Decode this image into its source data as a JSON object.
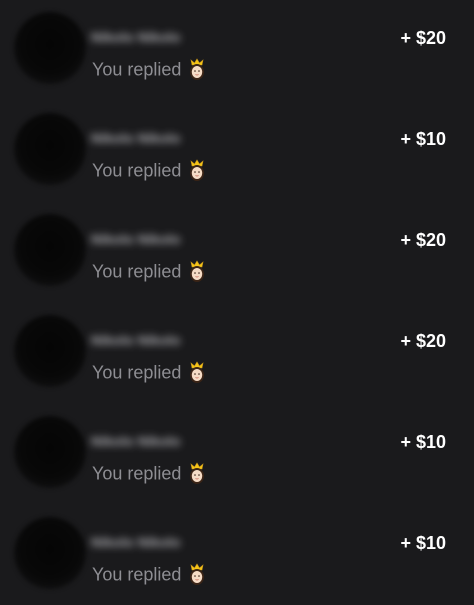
{
  "messages": [
    {
      "name": "Nikolo Nikolo",
      "subtitle": "You replied",
      "icon": "queen-emoji-icon",
      "amount": "+ $20"
    },
    {
      "name": "Nikolo Nikolo",
      "subtitle": "You replied",
      "icon": "queen-emoji-icon",
      "amount": "+ $10"
    },
    {
      "name": "Nikolo Nikolo",
      "subtitle": "You replied",
      "icon": "queen-emoji-icon",
      "amount": "+ $20"
    },
    {
      "name": "Nikolo Nikolo",
      "subtitle": "You replied",
      "icon": "queen-emoji-icon",
      "amount": "+ $20"
    },
    {
      "name": "Nikolo Nikolo",
      "subtitle": "You replied",
      "icon": "queen-emoji-icon",
      "amount": "+ $10"
    },
    {
      "name": "Nikolo Nikolo",
      "subtitle": "You replied",
      "icon": "queen-emoji-icon",
      "amount": "+ $10"
    }
  ],
  "colors": {
    "background": "#1a1a1c",
    "subtitle": "#8e8e93",
    "amount": "#ffffff"
  }
}
